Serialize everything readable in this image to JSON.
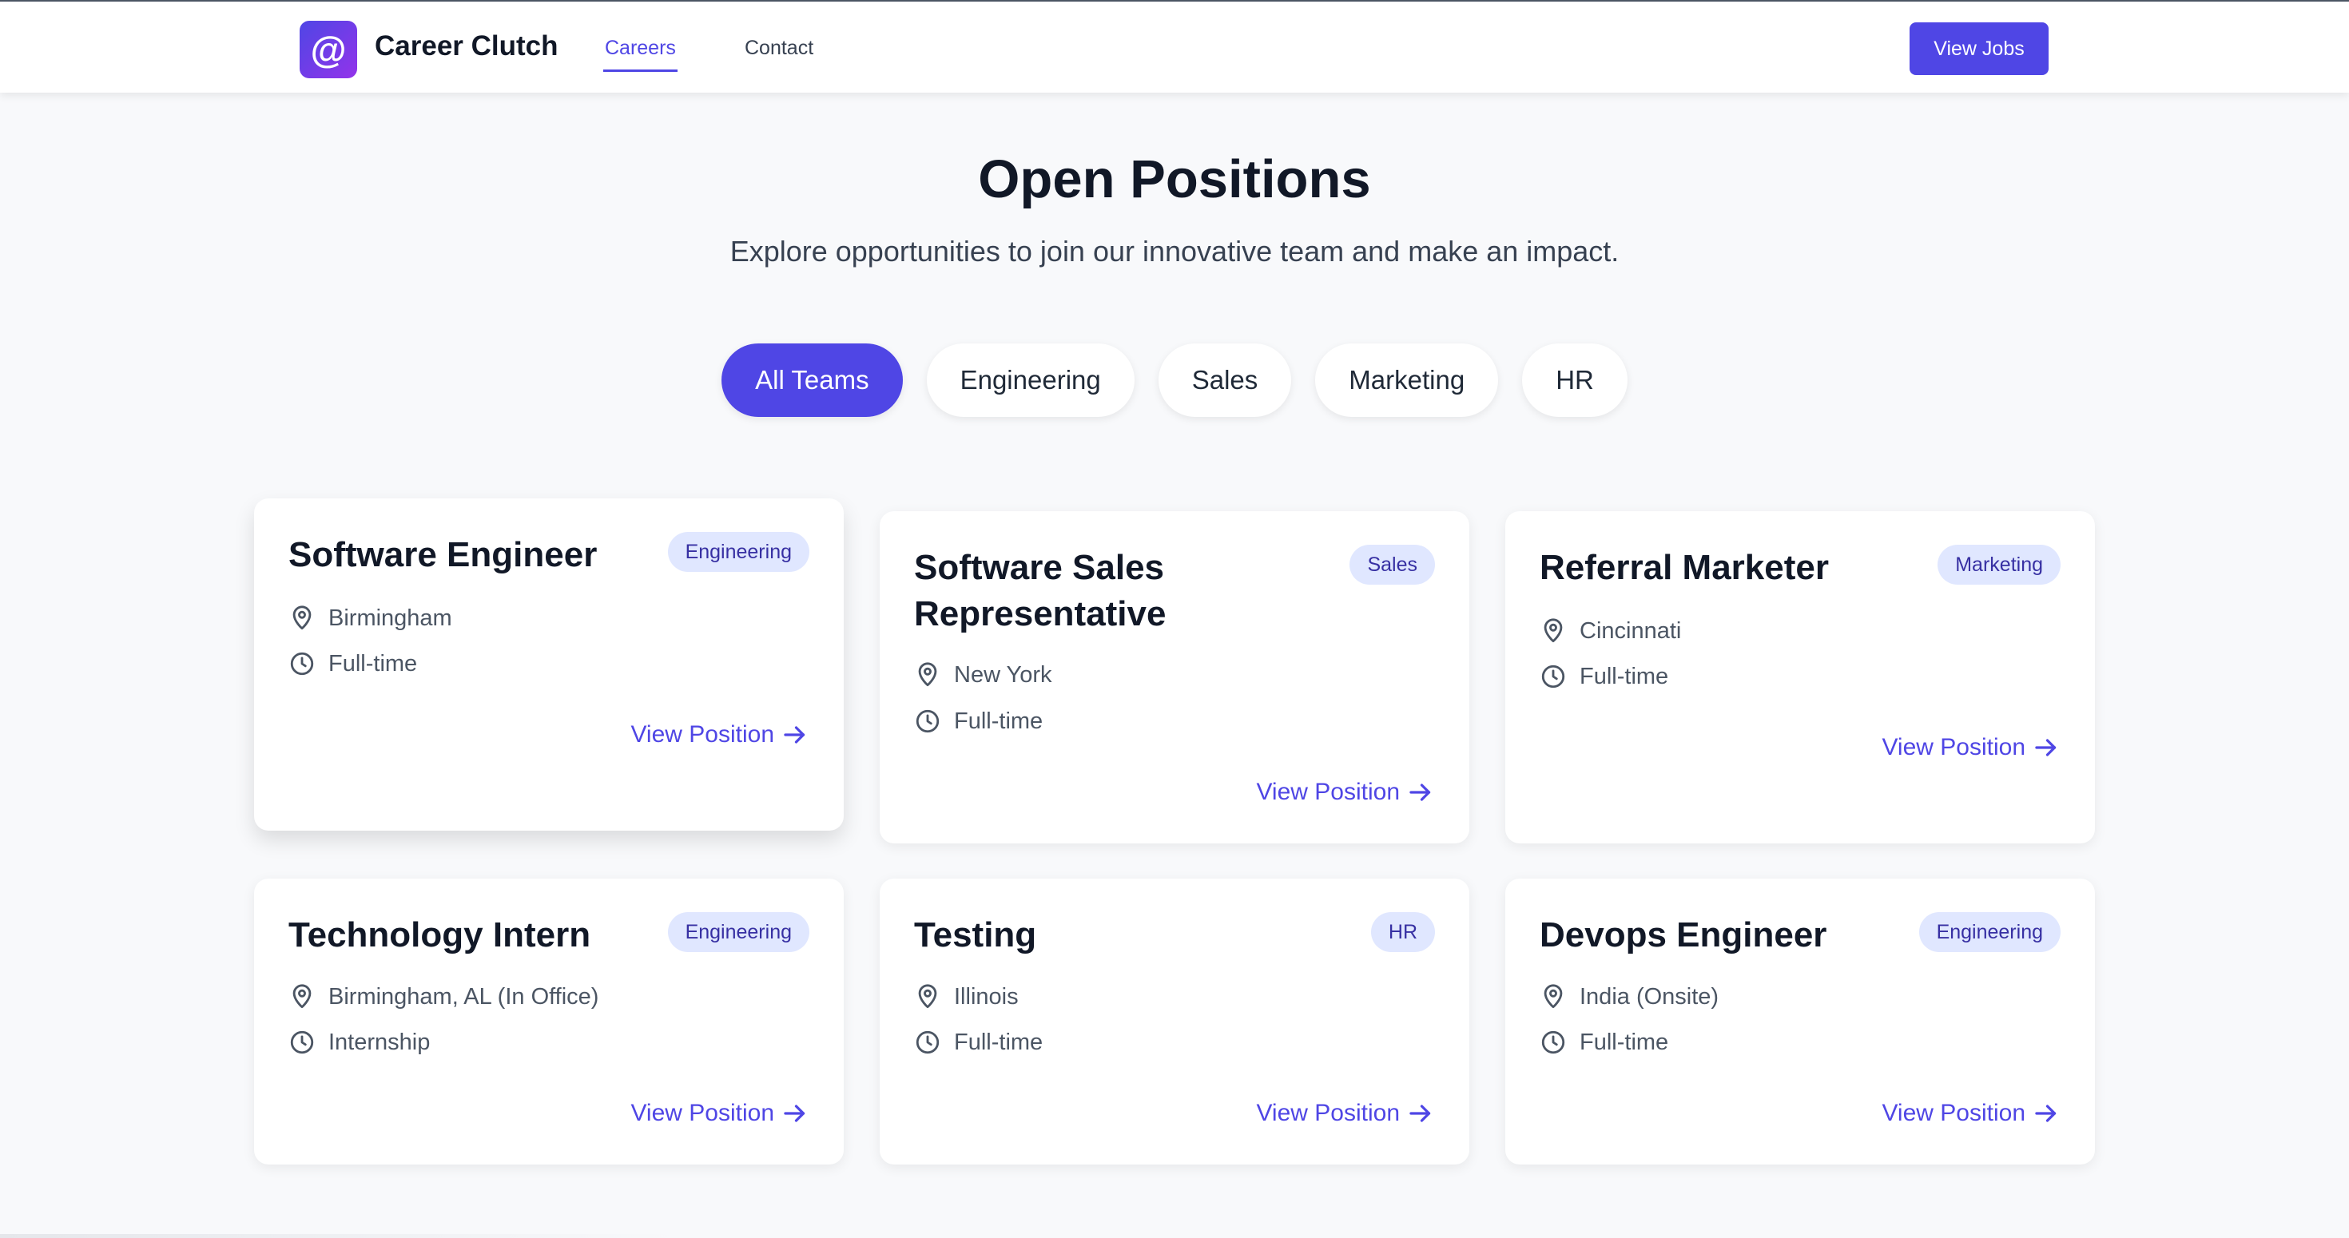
{
  "brand": {
    "logo_glyph": "@",
    "name": "Career Clutch"
  },
  "nav": {
    "careers": "Careers",
    "contact": "Contact",
    "cta": "View Jobs"
  },
  "hero": {
    "title": "Open Positions",
    "subtitle": "Explore opportunities to join our innovative team and make an impact."
  },
  "filters": [
    "All Teams",
    "Engineering",
    "Sales",
    "Marketing",
    "HR"
  ],
  "active_filter": "All Teams",
  "jobs": [
    {
      "title": "Software Engineer",
      "team": "Engineering",
      "location": "Birmingham",
      "type": "Full-time",
      "link": "View Position"
    },
    {
      "title": "Software Sales Representative",
      "team": "Sales",
      "location": "New York",
      "type": "Full-time",
      "link": "View Position"
    },
    {
      "title": "Referral Marketer",
      "team": "Marketing",
      "location": "Cincinnati",
      "type": "Full-time",
      "link": "View Position"
    },
    {
      "title": "Technology Intern",
      "team": "Engineering",
      "location": "Birmingham, AL (In Office)",
      "type": "Internship",
      "link": "View Position"
    },
    {
      "title": "Testing",
      "team": "HR",
      "location": "Illinois",
      "type": "Full-time",
      "link": "View Position"
    },
    {
      "title": "Devops Engineer",
      "team": "Engineering",
      "location": "India (Onsite)",
      "type": "Full-time",
      "link": "View Position"
    }
  ],
  "icons": {
    "location": "map-pin-icon",
    "job_type": "clock-icon",
    "link": "arrow-right-icon"
  },
  "colors": {
    "accent": "#4f46e5",
    "badge_bg": "#e0e7ff",
    "badge_text": "#3730a3",
    "background": "#f8f9fb"
  }
}
